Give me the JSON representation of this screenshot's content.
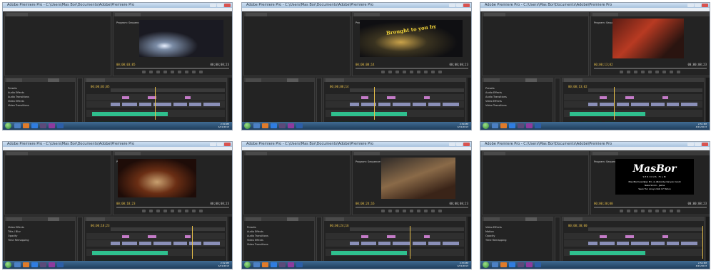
{
  "screens": [
    {
      "title": "Adobe Premiere Pro - C:\\Users\\Mas Bor\\Documents\\Adobe\\Premiere Pro",
      "program_label": "Program: Sequence 01",
      "menu": [
        "File",
        "Edit",
        "Project",
        "Clip",
        "Sequence",
        "Marker",
        "Title",
        "Window",
        "Help"
      ],
      "timecode_left": "00;00;03;05",
      "timecode_right": "00;00;08;23",
      "timeline_timecode": "00;00;03;05",
      "project_items": [
        "Presets",
        "Audio Effects",
        "Audio Transitions",
        "Video Effects",
        "Video Transitions"
      ],
      "audio_clip_label": "FULLMAN VIDEO DAWNLOAD ... NAMANYA",
      "clock": [
        "2:50 PM",
        "4/21/2013"
      ]
    },
    {
      "title": "Adobe Premiere Pro - C:\\Users\\Mas Bor\\Documents\\Adobe\\Premiere Pro",
      "program_label": "Program: Sequence 01",
      "menu": [
        "File",
        "Edit",
        "Project",
        "Clip",
        "Sequence",
        "Marker",
        "Title",
        "Window",
        "Help"
      ],
      "timecode_left": "00;00;08;14",
      "timecode_right": "00;00;08;23",
      "timeline_timecode": "00;00;08;14",
      "project_items": [],
      "audio_clip_label": "FULLMAN VIDEO DAWNLOAD ... NAMANYA",
      "clock": [
        "2:50 PM",
        "4/21/2013"
      ]
    },
    {
      "title": "Adobe Premiere Pro - C:\\Users\\Mas Bor\\Documents\\Adobe\\Premiere Pro",
      "program_label": "Program: Sequence 01",
      "menu": [
        "File",
        "Edit",
        "Project",
        "Clip",
        "Sequence",
        "Marker",
        "Title",
        "Window",
        "Help"
      ],
      "timecode_left": "00;00;13;02",
      "timecode_right": "00;00;08;23",
      "timeline_timecode": "00;00;13;02",
      "project_items": [
        "Presets",
        "Audio Effects",
        "Audio Transitions",
        "Video Effects",
        "Video Transitions"
      ],
      "audio_clip_label": "FULLMAN VIDEO DAWNLOAD ... NAMANYA",
      "clock": [
        "2:51 PM",
        "4/21/2013"
      ]
    },
    {
      "title": "Adobe Premiere Pro - C:\\Users\\Mas Bor\\Documents\\Adobe\\Premiere Pro",
      "program_label": "Program: Sequence 01",
      "menu": [
        "File",
        "Edit",
        "Project",
        "Clip",
        "Sequence",
        "Marker",
        "Title",
        "Window",
        "Help"
      ],
      "timecode_left": "00;00;18;23",
      "timecode_right": "00;00;08;23",
      "timeline_timecode": "00;00;18;23",
      "project_items": [
        "Video Effects",
        "Title / Blur",
        "Opacity",
        "Time Remapping"
      ],
      "audio_clip_label": "FULLMAN VIDEO DAWNLOAD ... NAMANYA",
      "clock": [
        "2:52 PM",
        "4/21/2013"
      ]
    },
    {
      "title": "Adobe Premiere Pro - C:\\Users\\Mas Bor\\Documents\\Adobe\\Premiere Pro",
      "program_label": "Program: Sequence 01",
      "menu": [
        "File",
        "Edit",
        "Project",
        "Clip",
        "Sequence",
        "Marker",
        "Title",
        "Window",
        "Help"
      ],
      "timecode_left": "00;00;24;16",
      "timecode_right": "00;00;08;23",
      "timeline_timecode": "00;00;24;16",
      "project_items": [
        "Presets",
        "Audio Effects",
        "Audio Transitions",
        "Video Effects",
        "Video Transitions"
      ],
      "audio_clip_label": "FULLMAN VIDEO DAWNLOAD ... NAMANYA",
      "clock": [
        "2:53 PM",
        "4/21/2013"
      ]
    },
    {
      "title": "Adobe Premiere Pro - C:\\Users\\Mas Bor\\Documents\\Adobe\\Premiere Pro",
      "program_label": "Program: Sequence 01",
      "menu": [
        "File",
        "Edit",
        "Project",
        "Clip",
        "Sequence",
        "Marker",
        "Title",
        "Window",
        "Help"
      ],
      "timecode_left": "00;00;30;00",
      "timecode_right": "00;00;08;23",
      "timeline_timecode": "00;00;30;00",
      "project_items": [
        "Video Effects",
        "Motion",
        "Opacity",
        "Time Remapping"
      ],
      "audio_clip_label": "FULLMAN VIDEO DAWNLOAD ... NAMANYA",
      "clock": [
        "2:54 PM",
        "4/21/2013"
      ]
    }
  ],
  "overlay": {
    "title_frame2": "Brought to you by",
    "brand": "MasBor",
    "brand_tag": "SERIOUS FILM",
    "credits_1": "Mas Bormowidjojo Pro. & (Nobody) Karyan Candi",
    "credits_2": "Naka Sirom - Jaima",
    "credits_3": "Seen Fun Anuyo Kob 17 Tahun"
  },
  "colors": {
    "panel": "#232323",
    "clip_video": "#8a8fb8",
    "clip_pink": "#c47bc8",
    "clip_audio": "#2fbf8e",
    "timecode": "#e8c04a"
  }
}
